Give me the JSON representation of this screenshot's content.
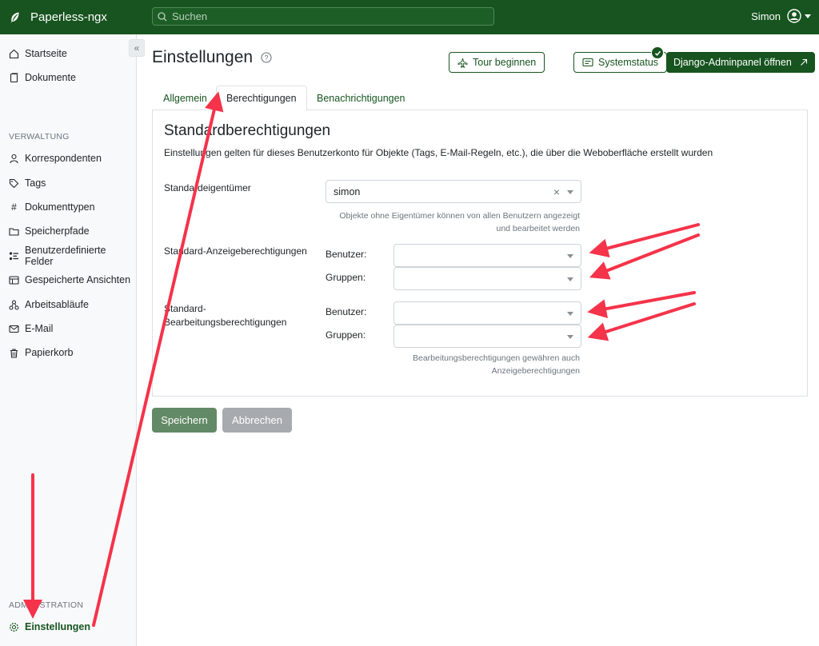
{
  "app": {
    "name": "Paperless-ngx"
  },
  "search": {
    "placeholder": "Suchen"
  },
  "user": {
    "name": "Simon"
  },
  "sidebar": {
    "items": [
      {
        "label": "Startseite"
      },
      {
        "label": "Dokumente"
      }
    ],
    "management_header": "VERWALTUNG",
    "management_items": [
      {
        "label": "Korrespondenten"
      },
      {
        "label": "Tags"
      },
      {
        "label": "Dokumenttypen"
      },
      {
        "label": "Speicherpfade"
      },
      {
        "label": "Benutzerdefinierte Felder"
      },
      {
        "label": "Gespeicherte Ansichten"
      },
      {
        "label": "Arbeitsabläufe"
      },
      {
        "label": "E-Mail"
      },
      {
        "label": "Papierkorb"
      }
    ],
    "admin_header": "ADMINISTRATION",
    "admin_items": [
      {
        "label": "Einstellungen"
      }
    ]
  },
  "page": {
    "title": "Einstellungen"
  },
  "header_buttons": {
    "tour": "Tour beginnen",
    "system_status": "Systemstatus",
    "django_admin": "Django-Adminpanel öffnen"
  },
  "tabs": [
    {
      "label": "Allgemein"
    },
    {
      "label": "Berechtigungen"
    },
    {
      "label": "Benachrichtigungen"
    }
  ],
  "permissions": {
    "title": "Standardberechtigungen",
    "description": "Einstellungen gelten für dieses Benutzerkonto für Objekte (Tags, E-Mail-Regeln, etc.), die über die Weboberfläche erstellt wurden",
    "owner_label": "Standardeigentümer",
    "owner_value": "simon",
    "owner_hint_1": "Objekte ohne Eigentümer können von allen Benutzern angezeigt",
    "owner_hint_2": "und bearbeitet werden",
    "view_label": "Standard-Anzeigeberechtigungen",
    "edit_label_1": "Standard-",
    "edit_label_2": "Bearbeitungsberechtigungen",
    "users_label": "Benutzer:",
    "groups_label": "Gruppen:",
    "edit_hint_1": "Bearbeitungsberechtigungen gewähren auch",
    "edit_hint_2": "Anzeigeberechtigungen"
  },
  "actions": {
    "save": "Speichern",
    "cancel": "Abbrechen"
  },
  "colors": {
    "brand": "#17541f",
    "annotation_arrow": "#f5334a"
  }
}
